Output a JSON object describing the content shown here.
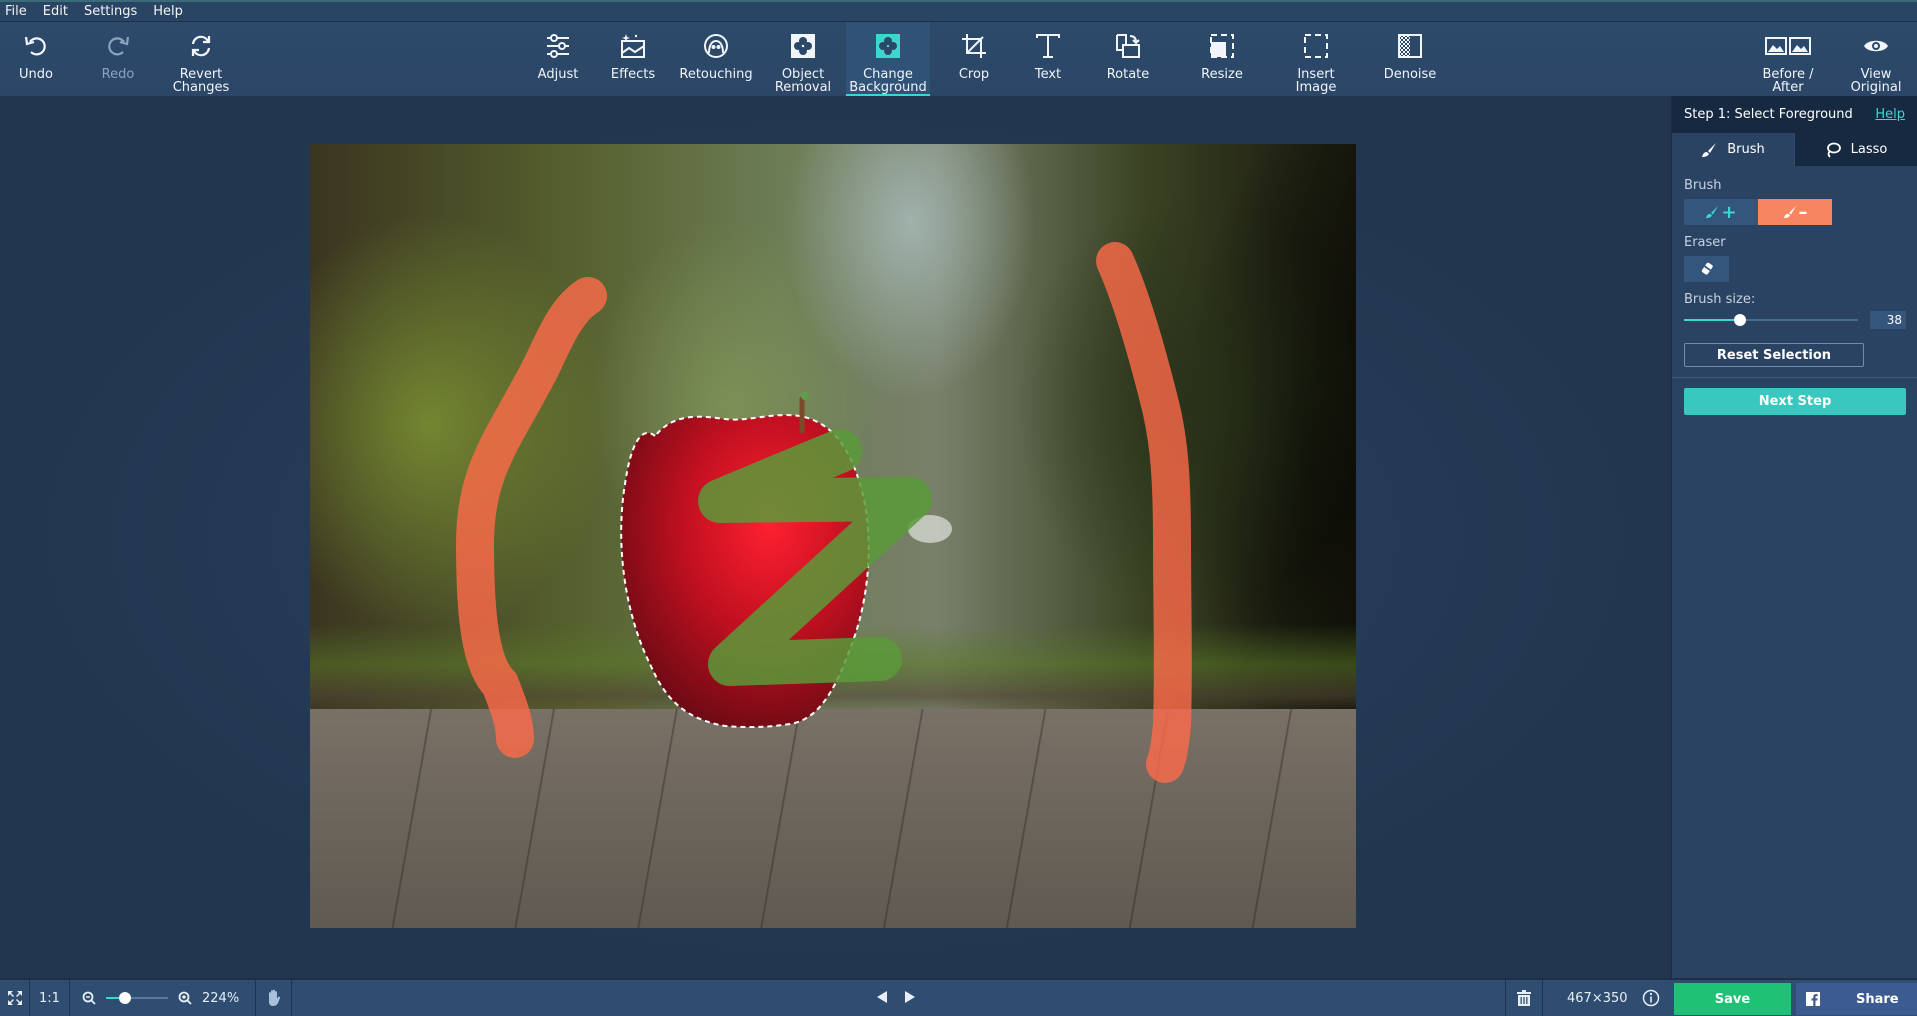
{
  "menu": [
    "File",
    "Edit",
    "Settings",
    "Help"
  ],
  "toolbar": {
    "undo": "Undo",
    "redo": "Redo",
    "revert": "Revert\nChanges",
    "adjust": "Adjust",
    "effects": "Effects",
    "retouching": "Retouching",
    "object_removal": "Object\nRemoval",
    "change_background": "Change\nBackground",
    "crop": "Crop",
    "text": "Text",
    "rotate": "Rotate",
    "resize": "Resize",
    "insert_image": "Insert\nImage",
    "denoise": "Denoise",
    "before_after": "Before /\nAfter",
    "view_original": "View\nOriginal",
    "active_tool": "Change Background"
  },
  "panel": {
    "step_title": "Step 1: Select Foreground",
    "help": "Help",
    "tabs": [
      {
        "label": "Brush",
        "active": true
      },
      {
        "label": "Lasso",
        "active": false
      }
    ],
    "brush_label": "Brush",
    "brush_add_symbol": "+",
    "brush_remove_symbol": "–",
    "eraser_label": "Eraser",
    "brush_size_label": "Brush size:",
    "brush_size_value": "38",
    "brush_size_fraction": 0.32,
    "reset_selection": "Reset Selection",
    "next_step": "Next Step"
  },
  "status": {
    "fit_icon": "fullscreen-icon",
    "one_to_one": "1:1",
    "zoom_percent": "224%",
    "zoom_slider_fraction": 0.3,
    "dimensions": "467×350",
    "save": "Save",
    "share": "Share"
  },
  "colors": {
    "accent": "#3dd6cd",
    "brush_remove": "#f78560",
    "save": "#1fc275",
    "share": "#3b5b91",
    "foreground_mark": "#5a9a3a",
    "background_mark": "#ff6a4a"
  }
}
